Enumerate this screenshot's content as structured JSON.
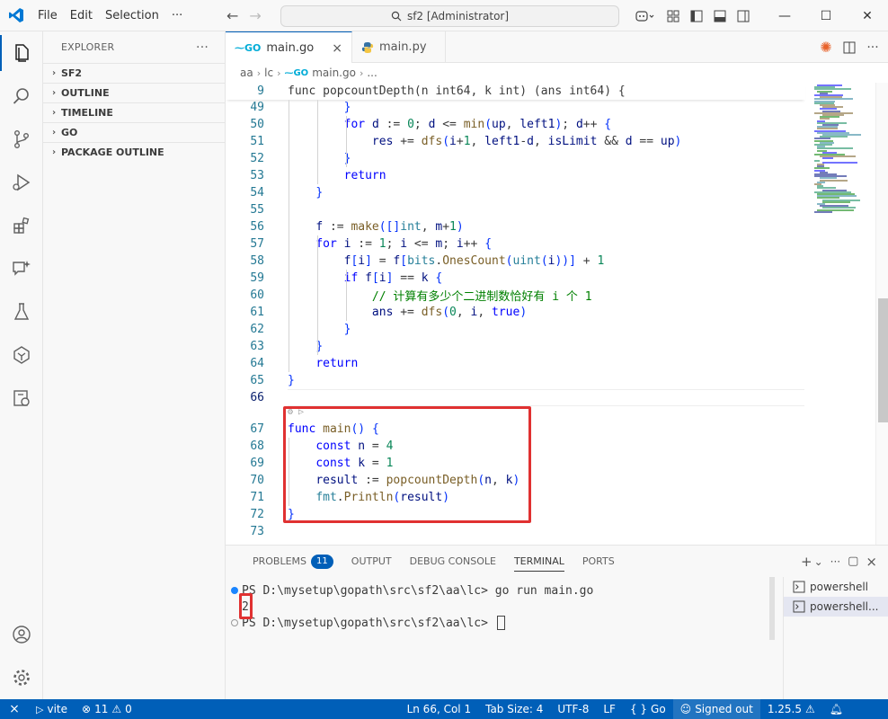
{
  "window": {
    "title": "sf2 [Administrator]"
  },
  "menu": [
    "File",
    "Edit",
    "Selection",
    "···"
  ],
  "sidebar": {
    "title": "EXPLORER",
    "more": "···",
    "sections": [
      "SF2",
      "OUTLINE",
      "TIMELINE",
      "GO",
      "PACKAGE OUTLINE"
    ]
  },
  "tabs": [
    {
      "label": "main.go",
      "active": true,
      "icon": "go-file-icon",
      "close": "×"
    },
    {
      "label": "main.py",
      "active": false,
      "icon": "python-file-icon"
    }
  ],
  "breadcrumb": [
    "aa",
    "lc",
    "main.go",
    "..."
  ],
  "editor": {
    "sticky": {
      "ln": "9",
      "code": "func popcountDepth(n int64, k int) (ans int64) {"
    },
    "lines": [
      {
        "ln": "49",
        "code": "        }"
      },
      {
        "ln": "50",
        "code": "        for d := 0; d <= min(up, left1); d++ {"
      },
      {
        "ln": "51",
        "code": "            res += dfs(i+1, left1-d, isLimit && d == up)"
      },
      {
        "ln": "52",
        "code": "        }"
      },
      {
        "ln": "53",
        "code": "        return"
      },
      {
        "ln": "54",
        "code": "    }"
      },
      {
        "ln": "55",
        "code": ""
      },
      {
        "ln": "56",
        "code": "    f := make([]int, m+1)"
      },
      {
        "ln": "57",
        "code": "    for i := 1; i <= m; i++ {"
      },
      {
        "ln": "58",
        "code": "        f[i] = f[bits.OnesCount(uint(i))] + 1"
      },
      {
        "ln": "59",
        "code": "        if f[i] == k {"
      },
      {
        "ln": "60",
        "code": "            // 计算有多少个二进制数恰好有 i 个 1"
      },
      {
        "ln": "61",
        "code": "            ans += dfs(0, i, true)"
      },
      {
        "ln": "62",
        "code": "        }"
      },
      {
        "ln": "63",
        "code": "    }"
      },
      {
        "ln": "64",
        "code": "    return"
      },
      {
        "ln": "65",
        "code": "}"
      },
      {
        "ln": "66",
        "code": ""
      },
      {
        "ln": "67",
        "code": "func main() {"
      },
      {
        "ln": "68",
        "code": "    const n = 4"
      },
      {
        "ln": "69",
        "code": "    const k = 1"
      },
      {
        "ln": "70",
        "code": "    result := popcountDepth(n, k)"
      },
      {
        "ln": "71",
        "code": "    fmt.Println(result)"
      },
      {
        "ln": "72",
        "code": "}"
      },
      {
        "ln": "73",
        "code": ""
      }
    ]
  },
  "panel": {
    "tabs": [
      {
        "label": "PROBLEMS",
        "badge": "11"
      },
      {
        "label": "OUTPUT"
      },
      {
        "label": "DEBUG CONSOLE"
      },
      {
        "label": "TERMINAL",
        "active": true
      },
      {
        "label": "PORTS"
      }
    ],
    "actions": [
      "+",
      "⌄",
      "···",
      "▢",
      "×"
    ],
    "terminal": {
      "line1": "PS D:\\mysetup\\gopath\\src\\sf2\\aa\\lc> go run main.go",
      "line2": "2",
      "line3": "PS D:\\mysetup\\gopath\\src\\sf2\\aa\\lc> "
    },
    "terminal_list": [
      "powershell",
      "powershell..."
    ]
  },
  "statusbar": {
    "remote": "⨯",
    "vite": "vite",
    "errors": "11",
    "warnings": "0",
    "position": "Ln 66, Col 1",
    "tabsize": "Tab Size: 4",
    "encoding": "UTF-8",
    "eol": "LF",
    "language": "Go",
    "signed": "Signed out",
    "version": "1.25.5"
  },
  "colors": {
    "accent": "#005fb8",
    "highlight": "#e03131"
  }
}
